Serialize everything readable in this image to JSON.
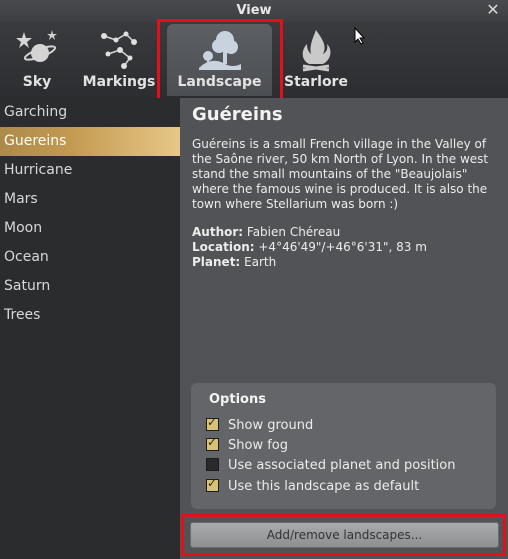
{
  "window": {
    "title": "View"
  },
  "tabs": [
    {
      "label": "Sky",
      "icon": "sky-icon"
    },
    {
      "label": "Markings",
      "icon": "markings-icon"
    },
    {
      "label": "Landscape",
      "icon": "landscape-icon"
    },
    {
      "label": "Starlore",
      "icon": "starlore-icon"
    }
  ],
  "sidebar": {
    "items": [
      "Garching",
      "Guereins",
      "Hurricane",
      "Mars",
      "Moon",
      "Ocean",
      "Saturn",
      "Trees"
    ],
    "selected": "Guereins"
  },
  "landscape": {
    "title": "Guéreins",
    "description": "Guéreins is a small French village in the Valley of the Saône river, 50 km North of Lyon. In the west stand the small mountains of the \"Beaujolais\" where the famous wine is produced. It is also the town where Stellarium was born :)",
    "author_label": "Author:",
    "author": "Fabien Chéreau",
    "location_label": "Location:",
    "location": "+4°46'49\"/+46°6'31\", 83 m",
    "planet_label": "Planet:",
    "planet": "Earth"
  },
  "options": {
    "heading": "Options",
    "items": [
      {
        "label": "Show ground",
        "checked": true
      },
      {
        "label": "Show fog",
        "checked": true
      },
      {
        "label": "Use associated planet and position",
        "checked": false
      },
      {
        "label": "Use this landscape as default",
        "checked": true
      }
    ]
  },
  "add_button": "Add/remove landscapes...",
  "colors": {
    "selected_item": "#c49a52",
    "highlight": "#e0101c"
  }
}
